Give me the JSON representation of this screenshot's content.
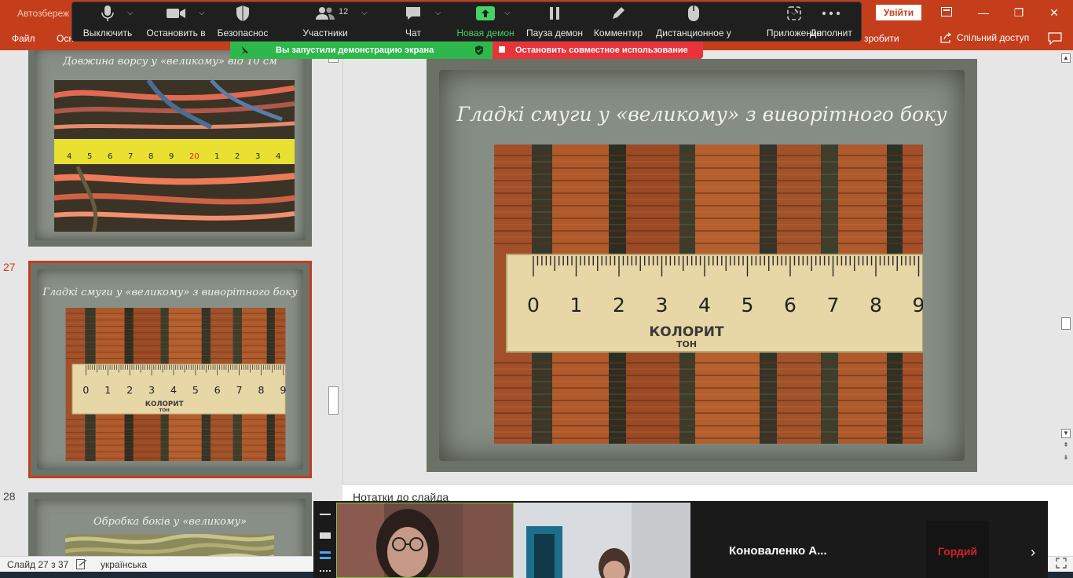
{
  "window": {
    "autosave_label": "Автозбереж",
    "signin_label": "Увійти",
    "minimize": "—",
    "restore": "❐",
    "close": "✕"
  },
  "ribbon": {
    "file_tab": "Файл",
    "home_tab_partial": "Осн",
    "tell_me_partial": "зробити",
    "share_label": "Спільний доступ"
  },
  "zoom_toolbar": {
    "mute": "Выключить",
    "stop_video": "Остановить в",
    "security": "Безопаснос",
    "participants": "Участники",
    "participants_count": "12",
    "chat": "Чат",
    "new_share": "Новая демон",
    "pause_share": "Пауза демон",
    "annotate": "Комментир",
    "remote_control": "Дистанционное у",
    "apps": "Приложения",
    "more": "Дополнит",
    "accent_green": "#45d164"
  },
  "share_banner": {
    "sharing_text": "Вы запустили демонстрацию экрана",
    "stop_text": "Остановить совместное использование"
  },
  "thumbnails": {
    "slide26_title": "Довжина ворсу у «великому» від 10 см",
    "slide27_num": "27",
    "slide27_title": "Гладкі смуги у «великому» з виворітного боку",
    "slide28_num": "28",
    "slide28_title": "Обробка боків у «великому»"
  },
  "main_slide": {
    "title": "Гладкі смуги у «великому» з виворітного боку",
    "ruler_digits": [
      "0",
      "1",
      "2",
      "3",
      "4",
      "5",
      "6",
      "7",
      "8",
      "9"
    ],
    "ruler_brand": "КОЛОРИТ",
    "ruler_sub": "ТОН"
  },
  "notes": {
    "label": "Нотатки до слайда"
  },
  "status": {
    "slide_counter": "Слайд 27 з 37",
    "language": "українська"
  },
  "video": {
    "participant3_name": "Коноваленко А...",
    "participant4_label": "Гордий"
  },
  "colors": {
    "ppt_accent": "#c43e1c",
    "share_green": "#2eb84b",
    "stop_red": "#e8333a"
  }
}
